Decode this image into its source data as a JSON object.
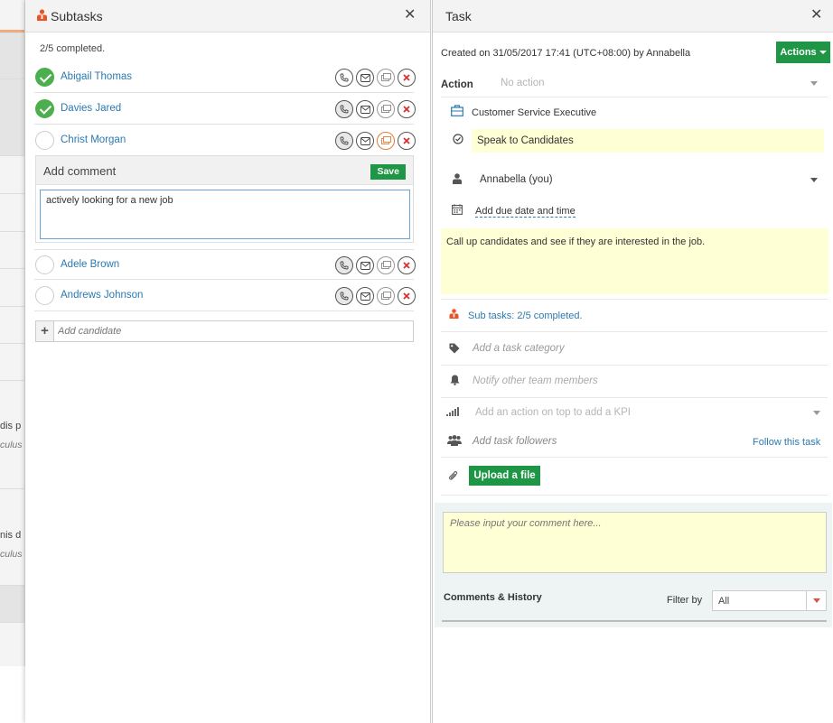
{
  "background": {
    "snippets": [
      {
        "text": "dis p",
        "italic": false
      },
      {
        "text": "culus",
        "italic": true
      },
      {
        "text": "nis d",
        "italic": false
      },
      {
        "text": "culus",
        "italic": true
      }
    ]
  },
  "subtasks": {
    "title": "Subtasks",
    "completed_text": "2/5 completed.",
    "items": [
      {
        "name": "Abigail Thomas",
        "done": true
      },
      {
        "name": "Davies Jared",
        "done": true
      },
      {
        "name": "Christ Morgan",
        "done": false
      },
      {
        "name": "Adele Brown",
        "done": false
      },
      {
        "name": "Andrews Johnson",
        "done": false
      }
    ],
    "comment": {
      "title": "Add comment",
      "save_label": "Save",
      "value": "actively looking for a new job"
    },
    "add_candidate_placeholder": "Add candidate"
  },
  "task": {
    "title": "Task",
    "created": "Created on 31/05/2017 17:41 (UTC+08:00) by Annabella",
    "actions_label": "Actions",
    "action_label": "Action",
    "action_placeholder": "No action",
    "role": "Customer Service Executive",
    "task_name": "Speak to Candidates",
    "assignee": "Annabella (you)",
    "due_date_link": "Add due date and time",
    "description": "Call up candidates and see if they are interested in the job.",
    "subtasks_link": "Sub tasks: 2/5 completed.",
    "category_placeholder": "Add a task category",
    "notify_placeholder": "Notify other team members",
    "kpi_placeholder": "Add an action on top to add a KPI",
    "followers_placeholder": "Add task followers",
    "follow_link": "Follow this task",
    "upload_label": "Upload a file",
    "comment_placeholder": "Please input your comment here...",
    "comments_title": "Comments & History",
    "filter_label": "Filter by",
    "filter_value": "All"
  },
  "colors": {
    "accent_green": "#1e9645",
    "link_blue": "#2a7ab0",
    "highlight_yellow": "#ffffd6",
    "icon_orange": "#e8532a"
  }
}
